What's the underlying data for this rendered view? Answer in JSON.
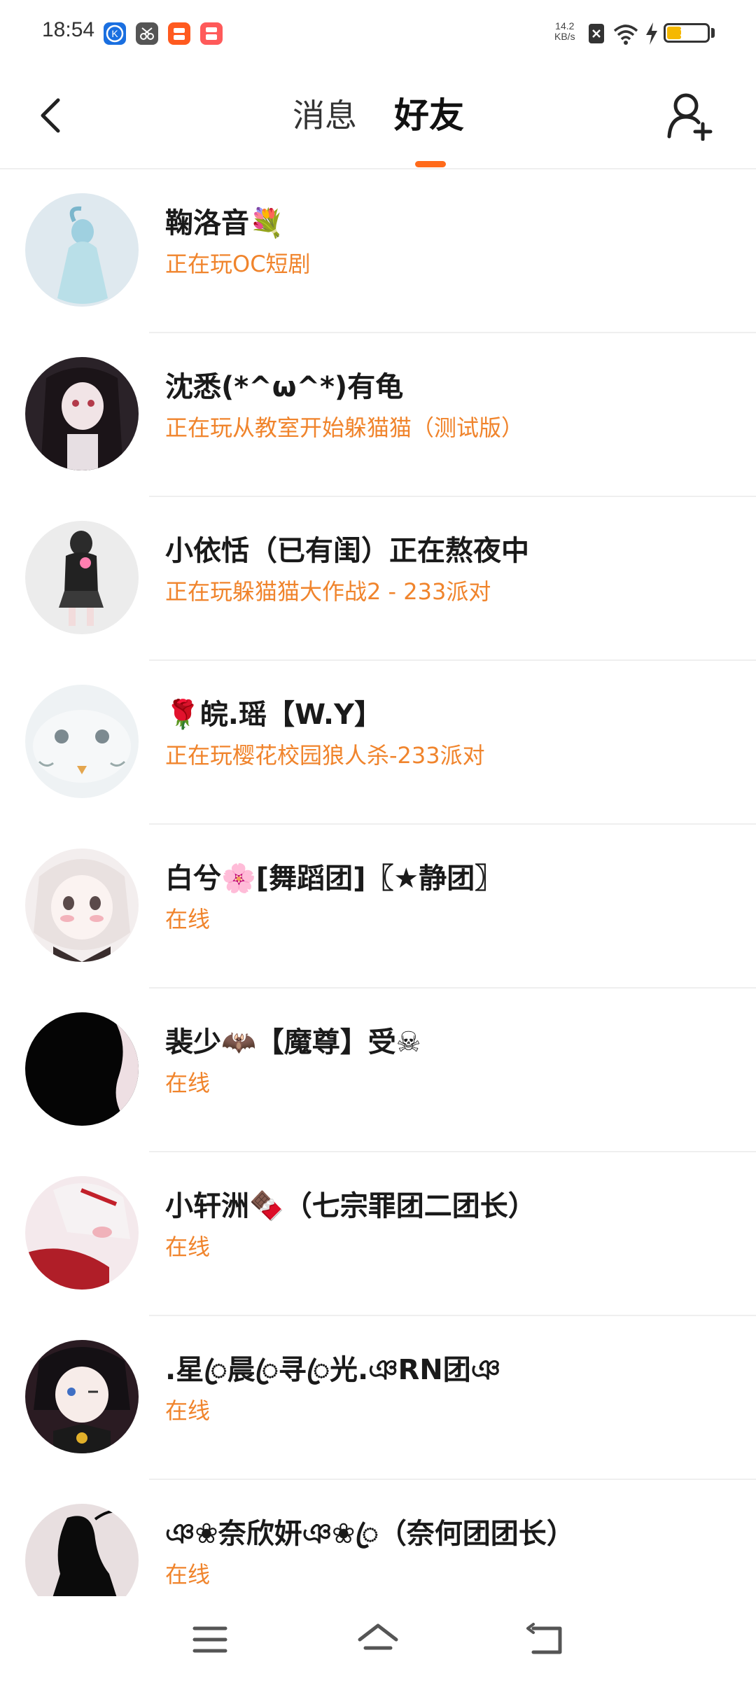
{
  "status_bar": {
    "time": "18:54",
    "net_speed_value": "14.2",
    "net_speed_unit": "KB/s",
    "battery": "30",
    "notification_icons": [
      "k-app-icon",
      "scissors-app-icon",
      "orange-app-icon",
      "red-app-icon"
    ]
  },
  "header": {
    "tab_messages": "消息",
    "tab_friends": "好友",
    "active_tab": "好友",
    "accent_color": "#ff6a1a"
  },
  "friends": [
    {
      "name": "鞠洛音💐",
      "status": "正在玩OC短剧"
    },
    {
      "name": "沈悉(*^ω^*)有龟",
      "status": "正在玩从教室开始躲猫猫（测试版）"
    },
    {
      "name": "小依恬（已有闺）正在熬夜中",
      "status": "正在玩躲猫猫大作战2 - 233派对"
    },
    {
      "name": "🌹皖.瑶【W.Y】",
      "status": "正在玩樱花校园狼人杀-233派对"
    },
    {
      "name": "白兮🌸[舞蹈团]〖★静团〗",
      "status": "在线"
    },
    {
      "name": "裴少🦇【魔尊】受☠",
      "status": "在线"
    },
    {
      "name": "小轩洲🍫（七宗罪团二团长）",
      "status": "在线"
    },
    {
      "name": ".星ꦿ晨ꦿ寻ꦿ光.ঞRN团ঞ",
      "status": "在线"
    },
    {
      "name": "ঞ❀奈欣妍ঞ❀ꦿ（奈何团团长）",
      "status": "在线"
    }
  ],
  "status_color": "#f0842c"
}
